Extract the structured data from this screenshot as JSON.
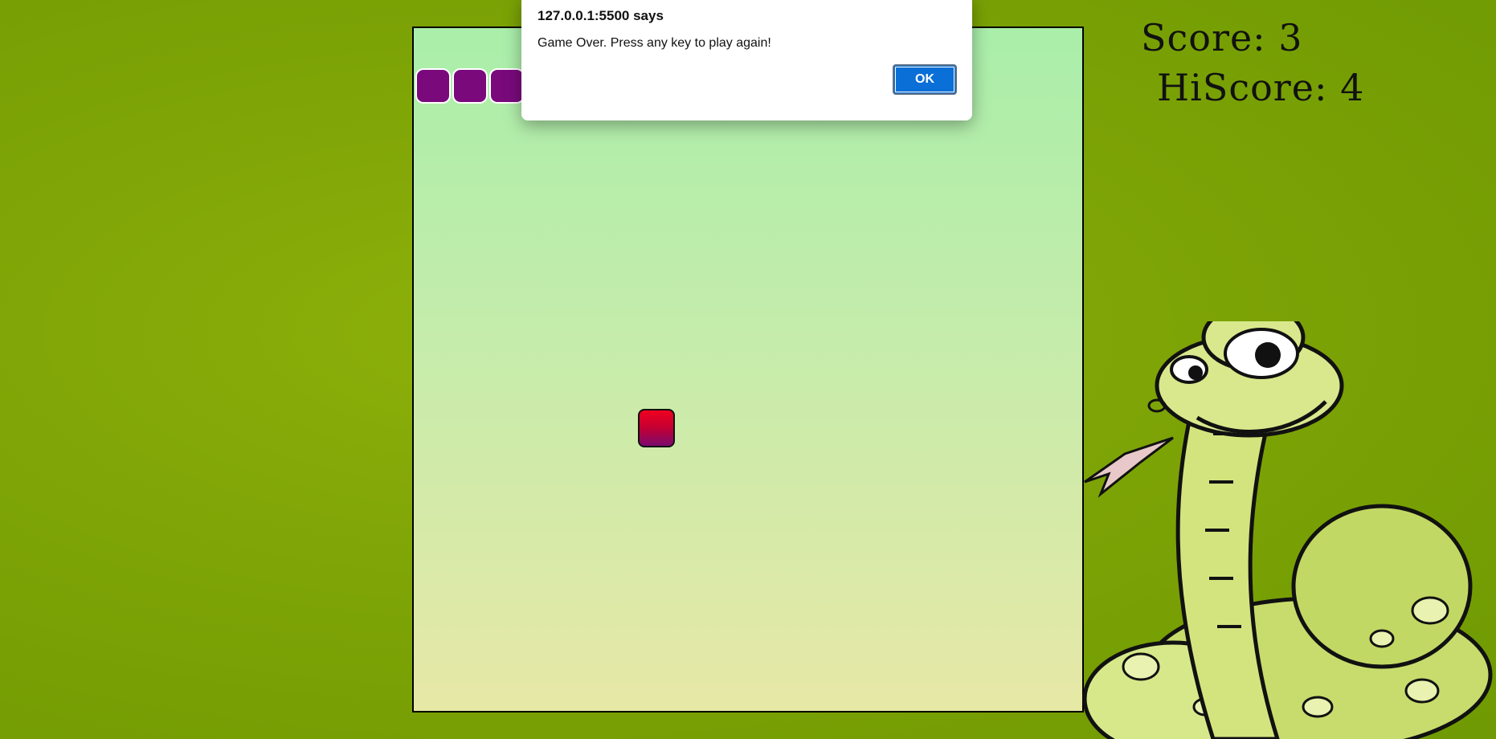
{
  "dialog": {
    "title": "127.0.0.1:5500 says",
    "message": "Game Over. Press any key to play again!",
    "ok_label": "OK"
  },
  "scoreboard": {
    "score_text": "Score: 3",
    "hiscore_text": "HiScore: 4",
    "score": 3,
    "hiscore": 4
  },
  "game": {
    "snake_color": "#7a0a7c",
    "food_colors": [
      "#f0001f",
      "#7b0a6e"
    ],
    "board_gradient": [
      "#a9eeaa",
      "#e7e8a6"
    ],
    "background_color": "#7ea406"
  },
  "mascot": {
    "icon": "cartoon-snake-icon"
  }
}
